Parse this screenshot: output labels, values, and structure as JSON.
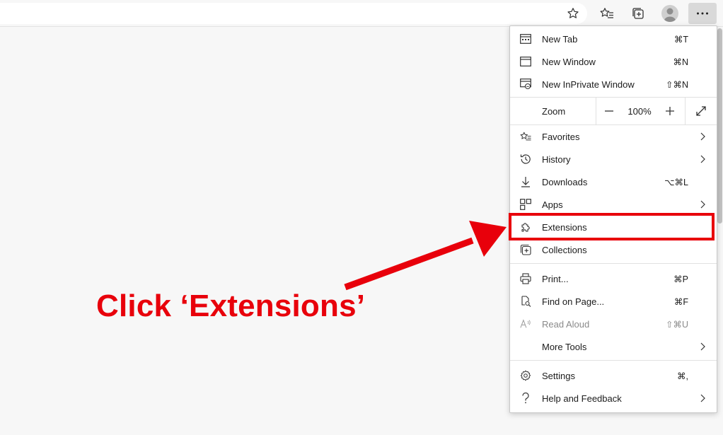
{
  "menu": {
    "new_tab": {
      "label": "New Tab",
      "shortcut": "⌘T"
    },
    "new_window": {
      "label": "New Window",
      "shortcut": "⌘N"
    },
    "new_inprivate": {
      "label": "New InPrivate Window",
      "shortcut": "⇧⌘N"
    },
    "zoom": {
      "label": "Zoom",
      "minus": "—",
      "value": "100%",
      "plus": "+"
    },
    "favorites": {
      "label": "Favorites"
    },
    "history": {
      "label": "History"
    },
    "downloads": {
      "label": "Downloads",
      "shortcut": "⌥⌘L"
    },
    "apps": {
      "label": "Apps"
    },
    "extensions": {
      "label": "Extensions"
    },
    "collections": {
      "label": "Collections"
    },
    "print": {
      "label": "Print...",
      "shortcut": "⌘P"
    },
    "find": {
      "label": "Find on Page...",
      "shortcut": "⌘F"
    },
    "read_aloud": {
      "label": "Read Aloud",
      "shortcut": "⇧⌘U"
    },
    "more_tools": {
      "label": "More Tools"
    },
    "settings": {
      "label": "Settings",
      "shortcut": "⌘,"
    },
    "help": {
      "label": "Help and Feedback"
    }
  },
  "annotation": {
    "text": "Click ‘Extensions’",
    "color": "#e8000b"
  },
  "icons": [
    "star-icon",
    "favorites-icon",
    "collections-icon",
    "avatar",
    "more-icon"
  ]
}
